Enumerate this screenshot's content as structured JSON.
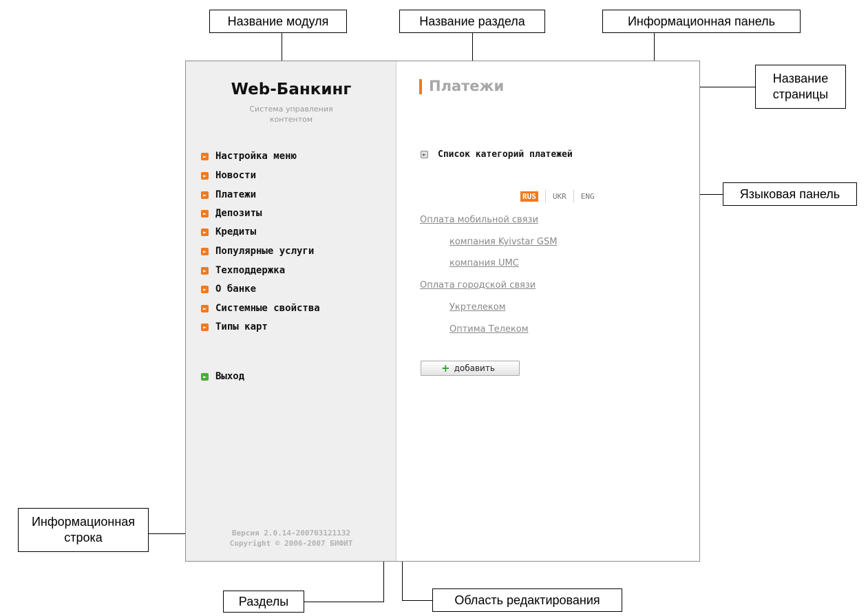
{
  "callouts": {
    "module_name": "Название модуля",
    "section_name": "Название раздела",
    "info_panel": "Информационная панель",
    "page_name": "Название\nстраницы",
    "language_panel": "Языковая панель",
    "info_line": "Информационная\nстрока",
    "sections": "Разделы",
    "edit_area": "Область редактирования"
  },
  "app": {
    "title": "Web-Банкинг",
    "subtitle": "Система управления\nконтентом",
    "footer": "Версия 2.0.14-200703121132\nCopyright © 2006-2007 БИФИТ"
  },
  "menu": {
    "items": [
      {
        "label": "Настройка меню"
      },
      {
        "label": "Новости"
      },
      {
        "label": "Платежи"
      },
      {
        "label": "Депозиты"
      },
      {
        "label": "Кредиты"
      },
      {
        "label": "Популярные услуги"
      },
      {
        "label": "Техподдержка"
      },
      {
        "label": "О банке"
      },
      {
        "label": "Системные свойства"
      },
      {
        "label": "Типы карт"
      }
    ],
    "logout": "Выход"
  },
  "main": {
    "section_title": "Платежи",
    "page_title": "Список категорий платежей",
    "languages": [
      "RUS",
      "UKR",
      "ENG"
    ],
    "active_language": "RUS",
    "categories": [
      {
        "label": "Оплата мобильной связи",
        "children": [
          "компания Kyivstar GSM",
          "компания UMC"
        ]
      },
      {
        "label": "Оплата городской связи",
        "children": [
          "Укртелеком",
          "Оптима Телеком"
        ]
      }
    ],
    "add_button": "добавить"
  },
  "colors": {
    "accent": "#f07a1f",
    "logout_bullet": "#4cad3a",
    "sidebar_bg": "#efefef",
    "link": "#888888",
    "add_plus": "#2b9e2b"
  }
}
